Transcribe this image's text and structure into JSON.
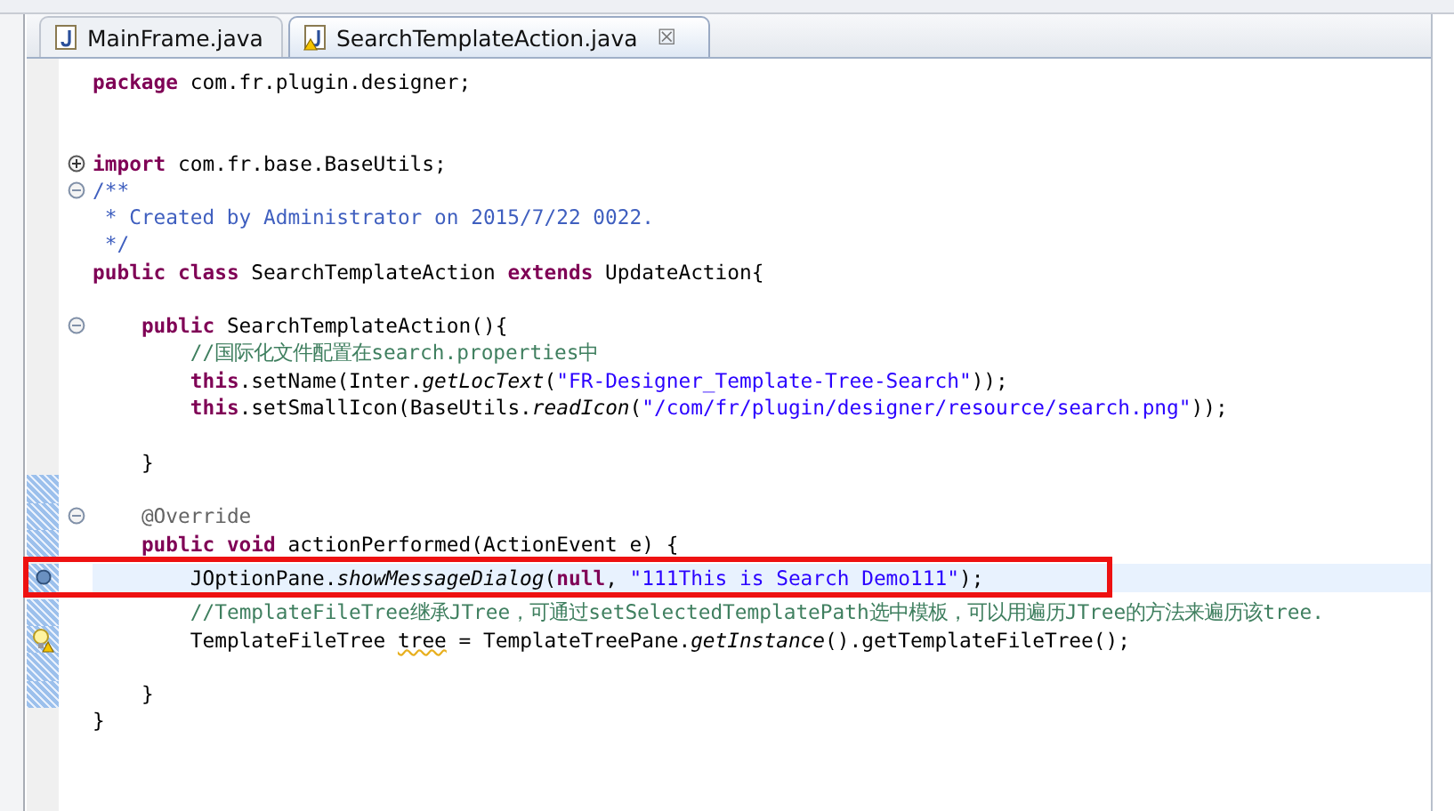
{
  "tabs": [
    {
      "label": "MainFrame.java",
      "selected": false,
      "warning": false
    },
    {
      "label": "SearchTemplateAction.java",
      "selected": true,
      "warning": true,
      "close": "☒"
    }
  ],
  "editor": {
    "lines": [
      {
        "kind": "code",
        "segments": [
          {
            "text": "package",
            "kind": "keyword"
          },
          {
            "text": " com.fr.plugin.designer;",
            "kind": "plain"
          }
        ]
      },
      {
        "kind": "blank"
      },
      {
        "kind": "blank"
      },
      {
        "kind": "code",
        "foldable": true,
        "expanded": false,
        "segments": [
          {
            "text": "import",
            "kind": "keyword"
          },
          {
            "text": " com.fr.base.BaseUtils;",
            "kind": "plain"
          }
        ]
      },
      {
        "kind": "code",
        "foldable": true,
        "expanded": true,
        "segments": [
          {
            "text": "/**",
            "kind": "javadoc"
          }
        ]
      },
      {
        "kind": "code",
        "segments": [
          {
            "text": " * Created by Administrator on 2015/7/22 0022.",
            "kind": "javadoc"
          }
        ]
      },
      {
        "kind": "code",
        "segments": [
          {
            "text": " */",
            "kind": "javadoc"
          }
        ]
      },
      {
        "kind": "code",
        "segments": [
          {
            "text": "public ",
            "kind": "keyword"
          },
          {
            "text": "class",
            "kind": "keyword"
          },
          {
            "text": " SearchTemplateAction ",
            "kind": "plain"
          },
          {
            "text": "extends",
            "kind": "keyword"
          },
          {
            "text": " UpdateAction{",
            "kind": "plain"
          }
        ]
      },
      {
        "kind": "blank"
      },
      {
        "kind": "code",
        "foldable": true,
        "expanded": true,
        "segments": [
          {
            "text": "    public",
            "kind": "keyword"
          },
          {
            "text": " SearchTemplateAction(){",
            "kind": "plain"
          }
        ]
      },
      {
        "kind": "code",
        "segments": [
          {
            "text": "        //国际化文件配置在search.properties中",
            "kind": "comment"
          }
        ]
      },
      {
        "kind": "code",
        "segments": [
          {
            "text": "        this",
            "kind": "keyword"
          },
          {
            "text": ".setName(Inter.",
            "kind": "plain"
          },
          {
            "text": "getLocText",
            "kind": "static"
          },
          {
            "text": "(",
            "kind": "plain"
          },
          {
            "text": "\"FR-Designer_Template-Tree-Search\"",
            "kind": "string"
          },
          {
            "text": "));",
            "kind": "plain"
          }
        ]
      },
      {
        "kind": "code",
        "segments": [
          {
            "text": "        this",
            "kind": "keyword"
          },
          {
            "text": ".setSmallIcon(BaseUtils.",
            "kind": "plain"
          },
          {
            "text": "readIcon",
            "kind": "static"
          },
          {
            "text": "(",
            "kind": "plain"
          },
          {
            "text": "\"/com/fr/plugin/designer/resource/search.png\"",
            "kind": "string"
          },
          {
            "text": "));",
            "kind": "plain"
          }
        ]
      },
      {
        "kind": "blank"
      },
      {
        "kind": "code",
        "segments": [
          {
            "text": "    }",
            "kind": "plain"
          }
        ]
      },
      {
        "kind": "blank",
        "changed": true
      },
      {
        "kind": "code",
        "foldable": true,
        "expanded": true,
        "changed": true,
        "segments": [
          {
            "text": "    @Override",
            "kind": "annotation"
          }
        ]
      },
      {
        "kind": "code",
        "changed": true,
        "segments": [
          {
            "text": "    public ",
            "kind": "keyword"
          },
          {
            "text": "void",
            "kind": "keyword"
          },
          {
            "text": " actionPerformed(ActionEvent e) {",
            "kind": "plain"
          }
        ]
      },
      {
        "kind": "code",
        "changed": true,
        "current": true,
        "breakpoint": true,
        "boxed": true,
        "segments": [
          {
            "text": "        JOptionPane.",
            "kind": "plain"
          },
          {
            "text": "showMessageDialog",
            "kind": "static"
          },
          {
            "text": "(",
            "kind": "plain"
          },
          {
            "text": "null",
            "kind": "keyword"
          },
          {
            "text": ", ",
            "kind": "plain"
          },
          {
            "text": "\"111This is Search Demo111\"",
            "kind": "string"
          },
          {
            "text": ");",
            "kind": "plain"
          }
        ]
      },
      {
        "kind": "code",
        "changed": true,
        "segments": [
          {
            "text": "        //TemplateFileTree继承JTree，可通过setSelectedTemplatePath选中模板，可以用遍历JTree的方法来遍历该tree.",
            "kind": "comment"
          }
        ]
      },
      {
        "kind": "code",
        "changed": true,
        "warning": true,
        "segments": [
          {
            "text": "        TemplateFileTree ",
            "kind": "plain"
          },
          {
            "text": "tree",
            "kind": "squiggle"
          },
          {
            "text": " = TemplateTreePane.",
            "kind": "plain"
          },
          {
            "text": "getInstance",
            "kind": "static"
          },
          {
            "text": "().getTemplateFileTree();",
            "kind": "plain"
          }
        ]
      },
      {
        "kind": "blank",
        "changed": true
      },
      {
        "kind": "code",
        "changed": true,
        "segments": [
          {
            "text": "    }",
            "kind": "plain"
          }
        ]
      },
      {
        "kind": "code",
        "segments": [
          {
            "text": "}",
            "kind": "plain"
          }
        ]
      }
    ]
  }
}
